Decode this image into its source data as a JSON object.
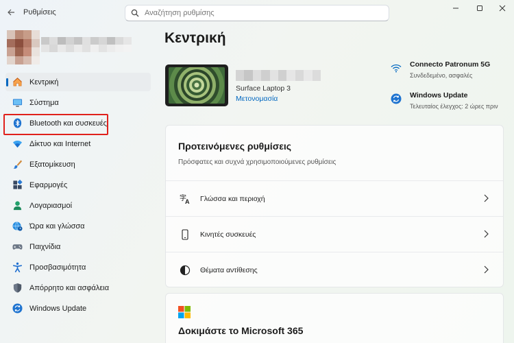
{
  "app": {
    "title": "Ρυθμίσεις"
  },
  "search": {
    "placeholder": "Αναζήτηση ρυθμίσης"
  },
  "sidebar": {
    "items": [
      {
        "label": "Κεντρική",
        "icon": "home-icon",
        "active": true
      },
      {
        "label": "Σύστημα",
        "icon": "system-icon"
      },
      {
        "label": "Bluetooth και συσκευές",
        "icon": "bluetooth-icon"
      },
      {
        "label": "Δίκτυο και Internet",
        "icon": "wifi-icon"
      },
      {
        "label": "Εξατομίκευση",
        "icon": "brush-icon"
      },
      {
        "label": "Εφαρμογές",
        "icon": "apps-icon"
      },
      {
        "label": "Λογαριασμοί",
        "icon": "person-icon"
      },
      {
        "label": "Ώρα και γλώσσα",
        "icon": "globe-clock-icon"
      },
      {
        "label": "Παιχνίδια",
        "icon": "gamepad-icon"
      },
      {
        "label": "Προσβασιμότητα",
        "icon": "accessibility-icon"
      },
      {
        "label": "Απόρρητο και ασφάλεια",
        "icon": "shield-icon"
      },
      {
        "label": "Windows Update",
        "icon": "update-icon"
      }
    ]
  },
  "main": {
    "title": "Κεντρική",
    "device": {
      "model": "Surface Laptop 3",
      "rename": "Μετονομασία"
    },
    "network": {
      "title": "Connecto Patronum 5G",
      "status": "Συνδεδεμένο, ασφαλές"
    },
    "update": {
      "title": "Windows Update",
      "status": "Τελευταίος έλεγχος: 2 ώρες πριν"
    },
    "recommended": {
      "title": "Προτεινόμενες ρυθμίσεις",
      "subtitle": "Πρόσφατες και συχνά χρησιμοποιούμενες ρυθμίσεις",
      "rows": [
        {
          "label": "Γλώσσα και περιοχή",
          "icon": "language-icon"
        },
        {
          "label": "Κινητές συσκευές",
          "icon": "phone-icon"
        },
        {
          "label": "Θέματα αντίθεσης",
          "icon": "contrast-icon"
        }
      ]
    },
    "ms365": {
      "title": "Δοκιμάστε το Microsoft 365"
    }
  },
  "colors": {
    "accent": "#0067c0",
    "highlight": "#e0201b"
  }
}
